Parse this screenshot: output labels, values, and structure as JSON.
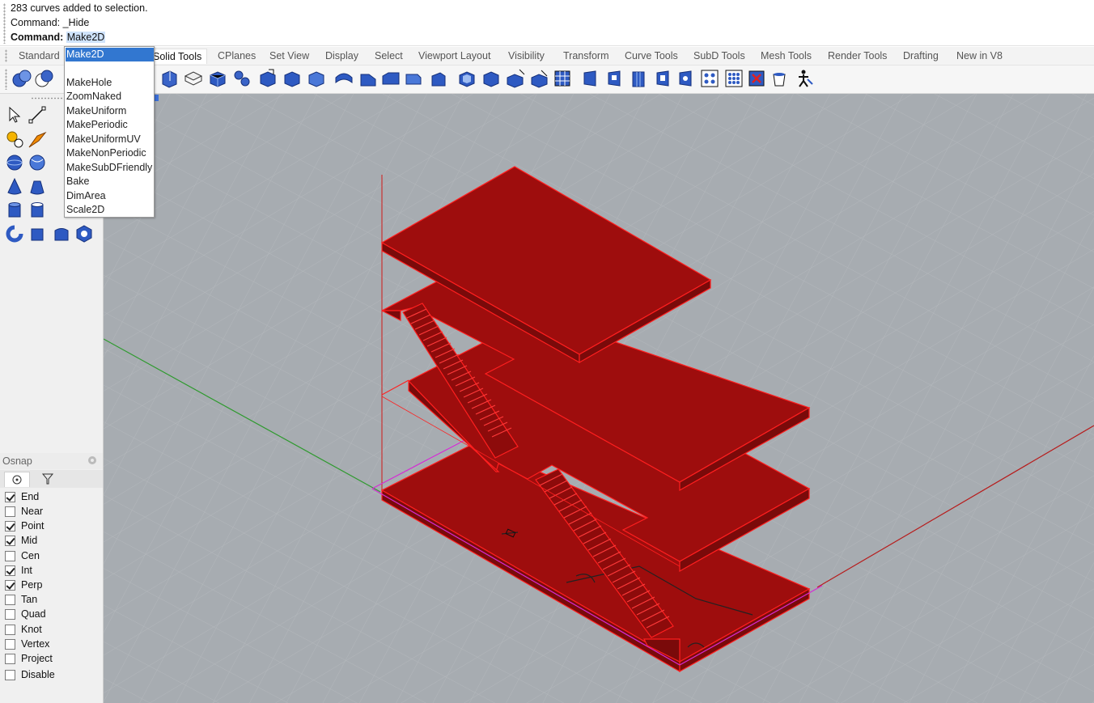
{
  "command_history": {
    "line1": "283 curves added to selection.",
    "line2": "Command: _Hide",
    "prompt_label": "Command:",
    "input_value": "Make2D"
  },
  "tabs": [
    {
      "label": "Standard"
    },
    {
      "label": "Solid Tools",
      "active": true
    },
    {
      "label": "CPlanes"
    },
    {
      "label": "Set View"
    },
    {
      "label": "Display"
    },
    {
      "label": "Select"
    },
    {
      "label": "Viewport Layout"
    },
    {
      "label": "Visibility"
    },
    {
      "label": "Transform"
    },
    {
      "label": "Curve Tools"
    },
    {
      "label": "SubD Tools"
    },
    {
      "label": "Mesh Tools"
    },
    {
      "label": "Render Tools"
    },
    {
      "label": "Drafting"
    },
    {
      "label": "New in V8"
    }
  ],
  "autocomplete": {
    "items": [
      {
        "label": "Make2D",
        "selected": true
      },
      {
        "label": "MakeHole"
      },
      {
        "label": "ZoomNaked"
      },
      {
        "label": "MakeUniform"
      },
      {
        "label": "MakePeriodic"
      },
      {
        "label": "MakeUniformUV"
      },
      {
        "label": "MakeNonPeriodic"
      },
      {
        "label": "MakeSubDFriendly"
      },
      {
        "label": "Bake"
      },
      {
        "label": "DimArea"
      },
      {
        "label": "Scale2D"
      }
    ]
  },
  "osnap": {
    "title": "Osnap",
    "items": [
      {
        "label": "End",
        "checked": true
      },
      {
        "label": "Near",
        "checked": false
      },
      {
        "label": "Point",
        "checked": true
      },
      {
        "label": "Mid",
        "checked": true
      },
      {
        "label": "Cen",
        "checked": false
      },
      {
        "label": "Int",
        "checked": true
      },
      {
        "label": "Perp",
        "checked": true
      },
      {
        "label": "Tan",
        "checked": false
      },
      {
        "label": "Quad",
        "checked": false
      },
      {
        "label": "Knot",
        "checked": false
      },
      {
        "label": "Vertex",
        "checked": false
      },
      {
        "label": "Project",
        "checked": false
      },
      {
        "label": "Disable",
        "checked": false
      }
    ]
  },
  "colors": {
    "viewport_bg": "#a7acb1",
    "grid_line": "#b9bdc1",
    "model_fill": "#9e0d0d",
    "model_edge": "#ff1a1a",
    "x_axis": "#b71c1c",
    "y_axis": "#2e9a2e",
    "selection_blue": "#3277d0"
  }
}
